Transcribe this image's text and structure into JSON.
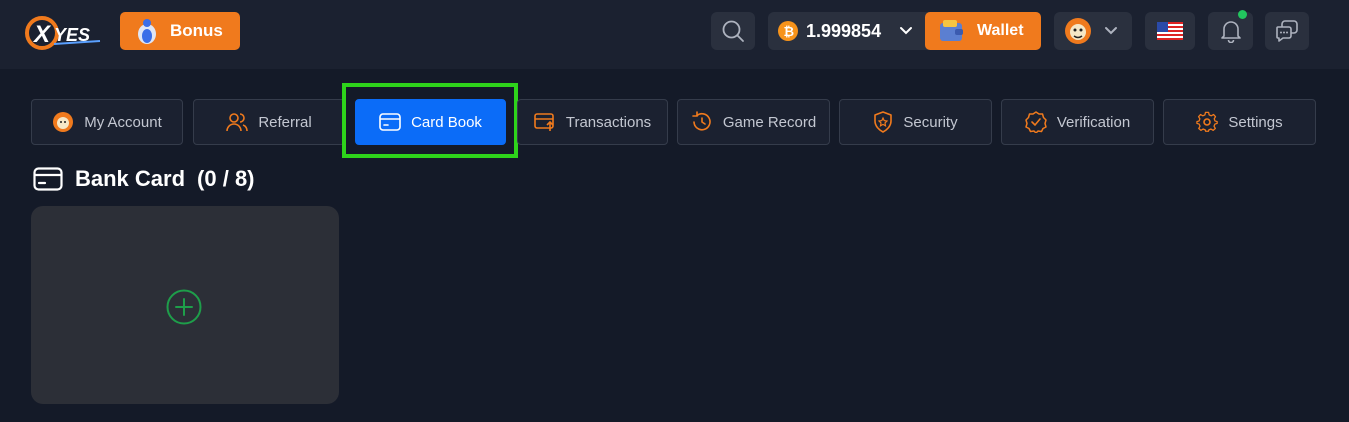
{
  "header": {
    "logo_text": "XYES",
    "bonus_label": "Bonus",
    "balance": "1.999854",
    "wallet_label": "Wallet",
    "icons": [
      "search-icon",
      "bitcoin-icon",
      "chevron-down-icon",
      "wallet-icon",
      "avatar",
      "us-flag-icon",
      "bell-icon",
      "chat-icon"
    ],
    "colors": {
      "accent_orange": "#f07a1d",
      "header_bg": "#1b2130",
      "online_dot": "#22c55e"
    }
  },
  "tabs": [
    {
      "label": "My Account",
      "icon": "avatar-icon"
    },
    {
      "label": "Referral",
      "icon": "users-icon"
    },
    {
      "label": "Card Book",
      "icon": "card-icon",
      "active": true
    },
    {
      "label": "Transactions",
      "icon": "transactions-icon"
    },
    {
      "label": "Game Record",
      "icon": "history-icon"
    },
    {
      "label": "Security",
      "icon": "shield-icon"
    },
    {
      "label": "Verification",
      "icon": "verified-icon"
    },
    {
      "label": "Settings",
      "icon": "gear-icon"
    }
  ],
  "section": {
    "title": "Bank Card",
    "count": "(0 / 8)",
    "add_icon": "plus-circle-icon"
  },
  "colors": {
    "active_tab": "#0b6cf8",
    "highlight_box": "#2ed41b",
    "plus_green": "#1e9e4a"
  }
}
